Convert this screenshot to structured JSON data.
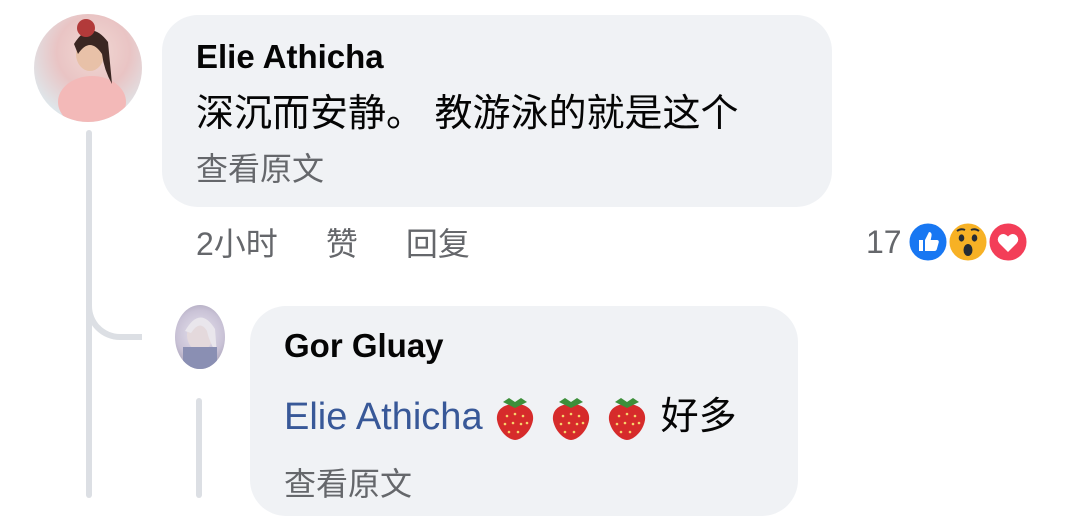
{
  "comment": {
    "author": "Elie Athicha",
    "text": "深沉而安静。 教游泳的就是这个",
    "see_translation": "查看原文",
    "time": "2小时",
    "like_label": "赞",
    "reply_label": "回复",
    "reaction_count": "17",
    "reactions": [
      "like-icon",
      "wow-icon",
      "love-icon"
    ]
  },
  "reply": {
    "author": "Gor Gluay",
    "mention": "Elie Athicha",
    "emoji": [
      "strawberry-icon",
      "strawberry-icon",
      "strawberry-icon"
    ],
    "text": "好多",
    "see_translation": "查看原文"
  },
  "colors": {
    "bubble": "#f0f2f5",
    "mention": "#385898",
    "meta_text": "#65676b",
    "like_blue": "#1877f2",
    "love_red": "#f33e58",
    "wow_yellow": "#f7b125"
  }
}
